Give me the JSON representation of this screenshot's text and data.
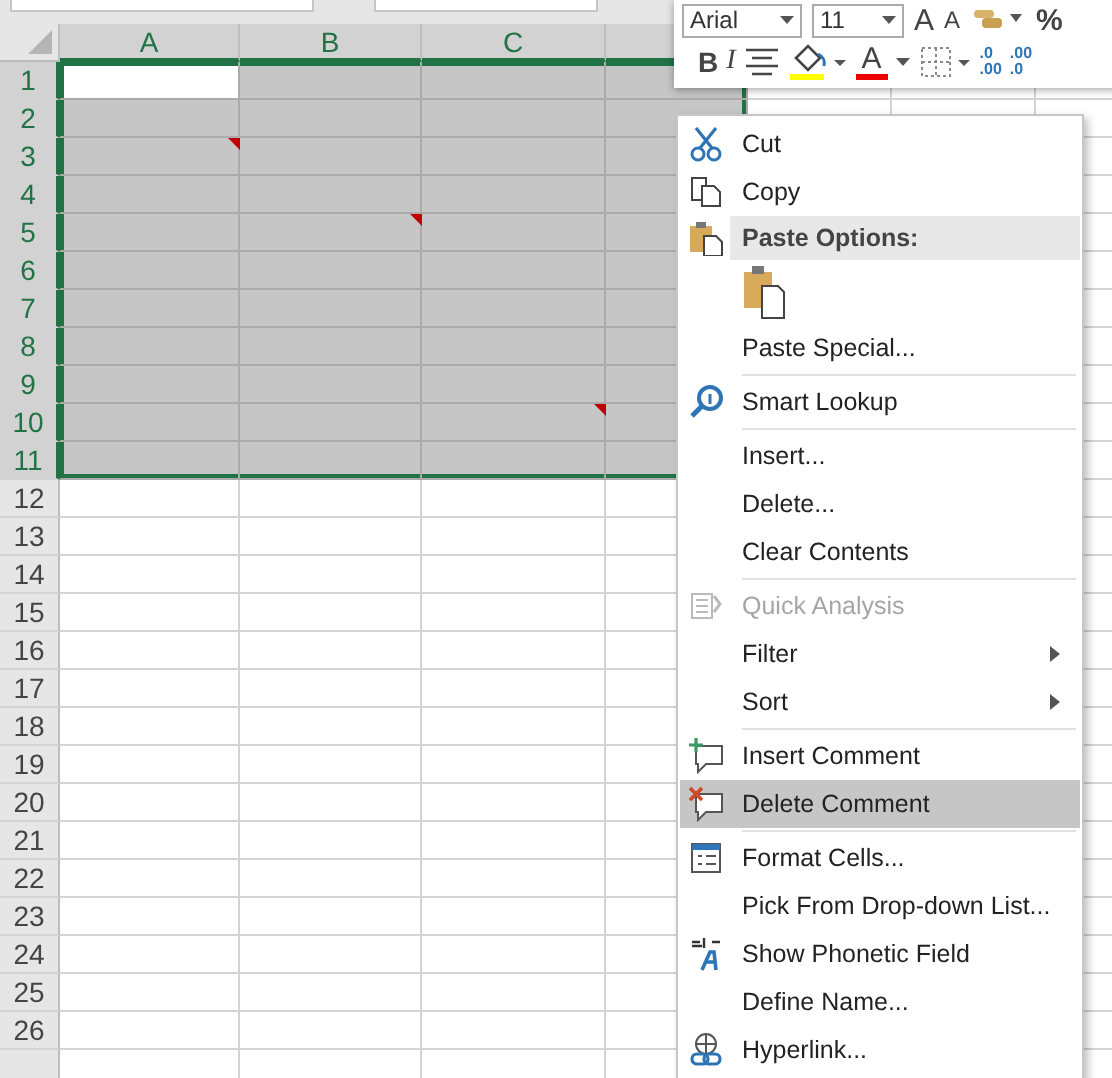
{
  "columns": [
    {
      "label": "A",
      "selected": true
    },
    {
      "label": "B",
      "selected": true
    },
    {
      "label": "C",
      "selected": true
    },
    {
      "selected": true
    }
  ],
  "rows": [
    {
      "label": "1",
      "selected": true,
      "cells": [
        {
          "active": true,
          "comment": false
        },
        {
          "active": false,
          "comment": false
        },
        {
          "active": false,
          "comment": false
        },
        {
          "active": false,
          "comment": false
        }
      ]
    },
    {
      "label": "2",
      "selected": true,
      "cells": [
        {
          "active": false,
          "comment": false
        },
        {
          "active": false,
          "comment": false
        },
        {
          "active": false,
          "comment": false
        },
        {
          "active": false,
          "comment": false
        }
      ]
    },
    {
      "label": "3",
      "selected": true,
      "cells": [
        {
          "active": false,
          "comment": true
        },
        {
          "active": false,
          "comment": false
        },
        {
          "active": false,
          "comment": false
        },
        {
          "active": false,
          "comment": false
        }
      ]
    },
    {
      "label": "4",
      "selected": true,
      "cells": [
        {
          "active": false,
          "comment": false
        },
        {
          "active": false,
          "comment": false
        },
        {
          "active": false,
          "comment": false
        },
        {
          "active": false,
          "comment": false
        }
      ]
    },
    {
      "label": "5",
      "selected": true,
      "cells": [
        {
          "active": false,
          "comment": false
        },
        {
          "active": false,
          "comment": true
        },
        {
          "active": false,
          "comment": false
        },
        {
          "active": false,
          "comment": false
        }
      ]
    },
    {
      "label": "6",
      "selected": true,
      "cells": [
        {
          "active": false,
          "comment": false
        },
        {
          "active": false,
          "comment": false
        },
        {
          "active": false,
          "comment": false
        },
        {
          "active": false,
          "comment": false
        }
      ]
    },
    {
      "label": "7",
      "selected": true,
      "cells": [
        {
          "active": false,
          "comment": false
        },
        {
          "active": false,
          "comment": false
        },
        {
          "active": false,
          "comment": false
        },
        {
          "active": false,
          "comment": false
        }
      ]
    },
    {
      "label": "8",
      "selected": true,
      "cells": [
        {
          "active": false,
          "comment": false
        },
        {
          "active": false,
          "comment": false
        },
        {
          "active": false,
          "comment": false
        },
        {
          "active": false,
          "comment": false
        }
      ]
    },
    {
      "label": "9",
      "selected": true,
      "cells": [
        {
          "active": false,
          "comment": false
        },
        {
          "active": false,
          "comment": false
        },
        {
          "active": false,
          "comment": false
        },
        {
          "active": false,
          "comment": false
        }
      ]
    },
    {
      "label": "10",
      "selected": true,
      "cells": [
        {
          "active": false,
          "comment": false
        },
        {
          "active": false,
          "comment": false
        },
        {
          "active": false,
          "comment": true
        },
        {
          "active": false,
          "comment": false
        }
      ]
    },
    {
      "label": "11",
      "selected": true,
      "cells": [
        {
          "active": false,
          "comment": false
        },
        {
          "active": false,
          "comment": false
        },
        {
          "active": false,
          "comment": false
        },
        {
          "active": false,
          "comment": false
        }
      ]
    },
    {
      "label": "12",
      "selected": false
    },
    {
      "label": "13",
      "selected": false
    },
    {
      "label": "14",
      "selected": false
    },
    {
      "label": "15",
      "selected": false
    },
    {
      "label": "16",
      "selected": false
    },
    {
      "label": "17",
      "selected": false
    },
    {
      "label": "18",
      "selected": false
    },
    {
      "label": "19",
      "selected": false
    },
    {
      "label": "20",
      "selected": false
    },
    {
      "label": "21",
      "selected": false
    },
    {
      "label": "22",
      "selected": false
    },
    {
      "label": "23",
      "selected": false
    },
    {
      "label": "24",
      "selected": false
    },
    {
      "label": "25",
      "selected": false
    },
    {
      "label": "26",
      "selected": false
    }
  ],
  "mini_toolbar": {
    "font": "Arial",
    "size": "11",
    "grow": "A",
    "shrink": "A",
    "percent": "%",
    "bold": "B",
    "italic": "I",
    "font_color": "A",
    "decimals": [
      {
        "top": ".0",
        "bottom": ".00"
      },
      {
        "top": ".00",
        "bottom": ".0"
      }
    ]
  },
  "context_menu": [
    {
      "kind": "item",
      "label": "Cut",
      "disabled": false,
      "selected": false,
      "submenu": false
    },
    {
      "kind": "item",
      "label": "Copy",
      "disabled": false,
      "selected": false,
      "submenu": false
    },
    {
      "kind": "header",
      "label": "Paste Options:"
    },
    {
      "kind": "paste-icons"
    },
    {
      "kind": "item",
      "label": "Paste Special...",
      "disabled": false,
      "selected": false,
      "submenu": false
    },
    {
      "kind": "separator"
    },
    {
      "kind": "item",
      "label": "Smart Lookup",
      "disabled": false,
      "selected": false,
      "submenu": false
    },
    {
      "kind": "separator"
    },
    {
      "kind": "item",
      "label": "Insert...",
      "disabled": false,
      "selected": false,
      "submenu": false
    },
    {
      "kind": "item",
      "label": "Delete...",
      "disabled": false,
      "selected": false,
      "submenu": false
    },
    {
      "kind": "item",
      "label": "Clear Contents",
      "disabled": false,
      "selected": false,
      "submenu": false
    },
    {
      "kind": "separator"
    },
    {
      "kind": "item",
      "label": "Quick Analysis",
      "disabled": true,
      "selected": false,
      "submenu": false
    },
    {
      "kind": "item",
      "label": "Filter",
      "disabled": false,
      "selected": false,
      "submenu": true
    },
    {
      "kind": "item",
      "label": "Sort",
      "disabled": false,
      "selected": false,
      "submenu": true
    },
    {
      "kind": "separator"
    },
    {
      "kind": "item",
      "label": "Insert Comment",
      "disabled": false,
      "selected": false,
      "submenu": false
    },
    {
      "kind": "item",
      "label": "Delete Comment",
      "disabled": false,
      "selected": true,
      "submenu": false
    },
    {
      "kind": "separator"
    },
    {
      "kind": "item",
      "label": "Format Cells...",
      "disabled": false,
      "selected": false,
      "submenu": false
    },
    {
      "kind": "item",
      "label": "Pick From Drop-down List...",
      "disabled": false,
      "selected": false,
      "submenu": false
    },
    {
      "kind": "item",
      "label": "Show Phonetic Field",
      "disabled": false,
      "selected": false,
      "submenu": false
    },
    {
      "kind": "item",
      "label": "Define Name...",
      "disabled": false,
      "selected": false,
      "submenu": false
    },
    {
      "kind": "item",
      "label": "Hyperlink...",
      "disabled": false,
      "selected": false,
      "submenu": false
    }
  ]
}
